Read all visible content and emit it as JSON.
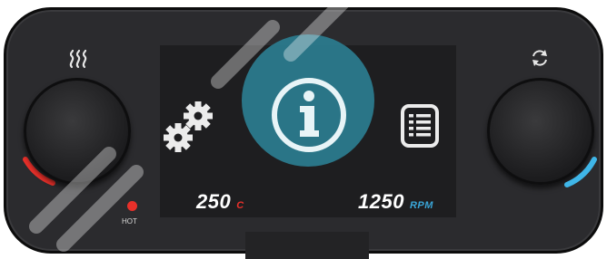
{
  "temperature": {
    "value": "250",
    "unit": "C",
    "unit_color": "#e8302a"
  },
  "speed": {
    "value": "1250",
    "unit": "RPM",
    "unit_color": "#3aa6d8"
  },
  "indicator": {
    "label": "HOT",
    "color": "#e8302a"
  },
  "accent": {
    "heat": "#e8302a",
    "spin": "#3fb6e8",
    "info": "#2b7d90"
  },
  "icons": {
    "heat": "heat-waves-icon",
    "spin": "refresh-icon",
    "settings": "gears-icon",
    "info": "info-icon",
    "list": "list-icon"
  }
}
